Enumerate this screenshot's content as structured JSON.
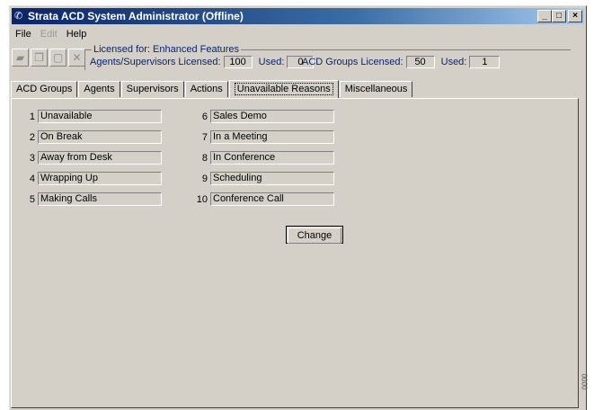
{
  "window": {
    "title": "Strata ACD System Administrator (Offline)",
    "controls": [
      "_",
      "□",
      "×"
    ]
  },
  "menu": [
    {
      "label": "File",
      "enabled": true
    },
    {
      "label": "Edit",
      "enabled": false
    },
    {
      "label": "Help",
      "enabled": true
    }
  ],
  "toolbar": {
    "open_icon": "folder-icon",
    "copy_icon": "copy-icon",
    "new_icon": "new-doc-icon",
    "delete_icon": "delete-icon"
  },
  "license": {
    "heading": "Licensed for: Enhanced Features",
    "agents_label": "Agents/Supervisors Licensed:",
    "agents_value": "100",
    "agents_used_label": "Used:",
    "agents_used_value": "0",
    "groups_label": "ACD Groups Licensed:",
    "groups_value": "50",
    "groups_used_label": "Used:",
    "groups_used_value": "1"
  },
  "tabs": [
    {
      "label": "ACD Groups",
      "active": false
    },
    {
      "label": "Agents",
      "active": false
    },
    {
      "label": "Supervisors",
      "active": false
    },
    {
      "label": "Actions",
      "active": false
    },
    {
      "label": "Unavailable Reasons",
      "active": true
    },
    {
      "label": "Miscellaneous",
      "active": false
    }
  ],
  "reasons_left": [
    {
      "num": "1",
      "value": "Unavailable"
    },
    {
      "num": "2",
      "value": "On Break"
    },
    {
      "num": "3",
      "value": "Away from Desk"
    },
    {
      "num": "4",
      "value": "Wrapping Up"
    },
    {
      "num": "5",
      "value": "Making Calls"
    }
  ],
  "reasons_right": [
    {
      "num": "6",
      "value": "Sales Demo"
    },
    {
      "num": "7",
      "value": "In a Meeting"
    },
    {
      "num": "8",
      "value": "In Conference"
    },
    {
      "num": "9",
      "value": "Scheduling"
    },
    {
      "num": "10",
      "value": "Conference Call"
    }
  ],
  "change_label": "Change",
  "side_mark": "0000"
}
